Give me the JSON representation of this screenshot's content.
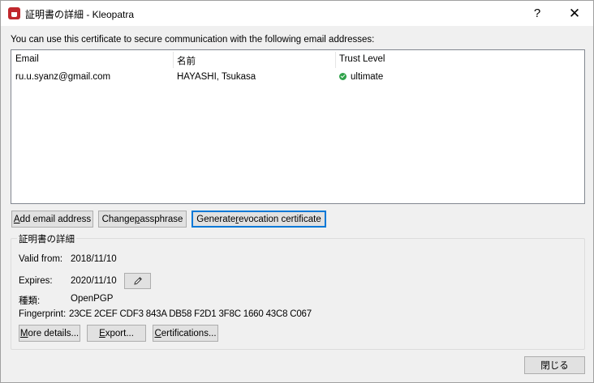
{
  "window": {
    "title": "証明書の詳細 - Kleopatra",
    "help_label": "?",
    "close_label": "✕"
  },
  "intro_text": "You can use this certificate to secure communication with the following email addresses:",
  "table": {
    "headers": [
      "Email",
      "名前",
      "Trust Level"
    ],
    "rows": [
      {
        "email": "ru.u.syanz@gmail.com",
        "name": "HAYASHI, Tsukasa",
        "trust": "ultimate",
        "trust_icon": "check-circle-icon"
      }
    ]
  },
  "buttons": {
    "add_email": {
      "u": "A",
      "rest": "dd email address"
    },
    "change_pass": {
      "pre": "Change ",
      "u": "p",
      "rest": "assphrase"
    },
    "gen_revoke": {
      "pre": "Generate ",
      "u": "r",
      "rest": "evocation certificate"
    }
  },
  "details": {
    "group_title": "証明書の詳細",
    "valid_from_label": "Valid from:",
    "valid_from": "2018/11/10",
    "expires_label": "Expires:",
    "expires": "2020/11/10",
    "type_label": "種類:",
    "type": "OpenPGP",
    "fingerprint_label": "Fingerprint:",
    "fingerprint": "23CE 2CEF CDF3 843A DB58 F2D1 3F8C 1660 43C8 C067",
    "more_details": {
      "u": "M",
      "rest": "ore details..."
    },
    "export": {
      "u": "E",
      "rest": "xport..."
    },
    "certifications": {
      "u": "C",
      "rest": "ertifications..."
    }
  },
  "close_button": "閉じる",
  "colors": {
    "accent": "#0078d7",
    "trust_ok": "#2fa24a",
    "app_icon": "#c0282d"
  }
}
